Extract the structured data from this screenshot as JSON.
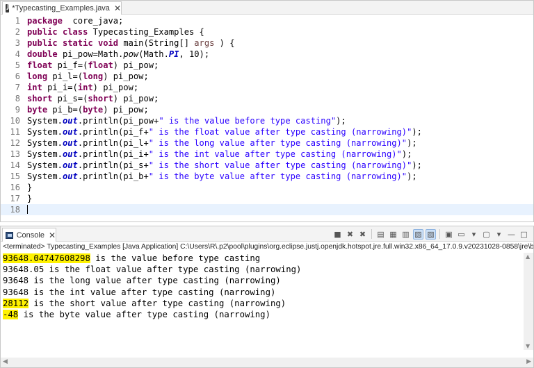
{
  "editor": {
    "tab_title": "*Typecasting_Examples.java",
    "tab_icon": "java-file-icon",
    "close_glyph": "✕",
    "lines": [
      {
        "n": "1",
        "segments": [
          [
            "kw",
            "package"
          ],
          [
            "",
            "  core_java;"
          ]
        ]
      },
      {
        "n": "2",
        "segments": [
          [
            "kw",
            "public"
          ],
          [
            "",
            " "
          ],
          [
            "kw",
            "class"
          ],
          [
            "",
            " Typecasting_Examples {"
          ]
        ]
      },
      {
        "n": "3",
        "segments": [
          [
            "kw",
            "public"
          ],
          [
            "",
            " "
          ],
          [
            "kw",
            "static"
          ],
          [
            "",
            " "
          ],
          [
            "kw",
            "void"
          ],
          [
            "",
            " main(String[] "
          ],
          [
            "var",
            "args"
          ],
          [
            "",
            " ) {"
          ]
        ]
      },
      {
        "n": "4",
        "segments": [
          [
            "kw",
            "double"
          ],
          [
            "",
            " pi_pow=Math."
          ],
          [
            "mth",
            "pow"
          ],
          [
            "",
            "(Math."
          ],
          [
            "sfld",
            "PI"
          ],
          [
            "",
            ", 10);"
          ]
        ]
      },
      {
        "n": "5",
        "segments": [
          [
            "kw",
            "float"
          ],
          [
            "",
            " pi_f=("
          ],
          [
            "kw",
            "float"
          ],
          [
            "",
            ") pi_pow;"
          ]
        ]
      },
      {
        "n": "6",
        "segments": [
          [
            "kw",
            "long"
          ],
          [
            "",
            " pi_l=("
          ],
          [
            "kw",
            "long"
          ],
          [
            "",
            ") pi_pow;"
          ]
        ]
      },
      {
        "n": "7",
        "segments": [
          [
            "kw",
            "int"
          ],
          [
            "",
            " pi_i=("
          ],
          [
            "kw",
            "int"
          ],
          [
            "",
            ") pi_pow;"
          ]
        ]
      },
      {
        "n": "8",
        "segments": [
          [
            "kw",
            "short"
          ],
          [
            "",
            " pi_s=("
          ],
          [
            "kw",
            "short"
          ],
          [
            "",
            ") pi_pow;"
          ]
        ]
      },
      {
        "n": "9",
        "segments": [
          [
            "kw",
            "byte"
          ],
          [
            "",
            " pi_b=("
          ],
          [
            "kw",
            "byte"
          ],
          [
            "",
            ") pi_pow;"
          ]
        ]
      },
      {
        "n": "10",
        "segments": [
          [
            "",
            "System."
          ],
          [
            "fld",
            "out"
          ],
          [
            "",
            ".println(pi_pow+"
          ],
          [
            "str",
            "\" is the value before type casting\""
          ],
          [
            "",
            ");"
          ]
        ]
      },
      {
        "n": "11",
        "segments": [
          [
            "",
            "System."
          ],
          [
            "fld",
            "out"
          ],
          [
            "",
            ".println(pi_f+"
          ],
          [
            "str",
            "\" is the float value after type casting (narrowing)\""
          ],
          [
            "",
            ");"
          ]
        ]
      },
      {
        "n": "12",
        "segments": [
          [
            "",
            "System."
          ],
          [
            "fld",
            "out"
          ],
          [
            "",
            ".println(pi_l+"
          ],
          [
            "str",
            "\" is the long value after type casting (narrowing)\""
          ],
          [
            "",
            ");"
          ]
        ]
      },
      {
        "n": "13",
        "segments": [
          [
            "",
            "System."
          ],
          [
            "fld",
            "out"
          ],
          [
            "",
            ".println(pi_i+"
          ],
          [
            "str",
            "\" is the int value after type casting (narrowing)\""
          ],
          [
            "",
            ");"
          ]
        ]
      },
      {
        "n": "14",
        "segments": [
          [
            "",
            "System."
          ],
          [
            "fld",
            "out"
          ],
          [
            "",
            ".println(pi_s+"
          ],
          [
            "str",
            "\" is the short value after type casting (narrowing)\""
          ],
          [
            "",
            ");"
          ]
        ]
      },
      {
        "n": "15",
        "segments": [
          [
            "",
            "System."
          ],
          [
            "fld",
            "out"
          ],
          [
            "",
            ".println(pi_b+"
          ],
          [
            "str",
            "\" is the byte value after type casting (narrowing)\""
          ],
          [
            "",
            ");"
          ]
        ]
      },
      {
        "n": "16",
        "segments": [
          [
            "",
            "}"
          ]
        ]
      },
      {
        "n": "17",
        "segments": [
          [
            "",
            "}"
          ]
        ]
      },
      {
        "n": "18",
        "segments": [],
        "current": true
      }
    ]
  },
  "console": {
    "tab_title": "Console",
    "tab_icon": "console-icon",
    "close_glyph": "✕",
    "status": "<terminated> Typecasting_Examples [Java Application] C:\\Users\\R\\.p2\\pool\\plugins\\org.eclipse.justj.openjdk.hotspot.jre.full.win32.x86_64_17.0.9.v20231028-0858\\jre\\bin\\ja",
    "output": [
      {
        "value": "93648.04747608298",
        "highlight": true,
        "rest": " is the value before type casting"
      },
      {
        "value": "93648.05",
        "highlight": false,
        "rest": " is the float value after type casting (narrowing)"
      },
      {
        "value": "93648",
        "highlight": false,
        "rest": " is the long value after type casting (narrowing)"
      },
      {
        "value": "93648",
        "highlight": false,
        "rest": " is the int value after type casting (narrowing)"
      },
      {
        "value": "28112",
        "highlight": true,
        "rest": " is the short value after type casting (narrowing)"
      },
      {
        "value": "-48",
        "highlight": true,
        "rest": " is the byte value after type casting (narrowing)"
      }
    ]
  },
  "colors": {
    "keyword": "#7f0055",
    "string": "#2a00ff",
    "field": "#0000c0",
    "highlight": "#fff200",
    "current_line": "#e8f2fe"
  }
}
